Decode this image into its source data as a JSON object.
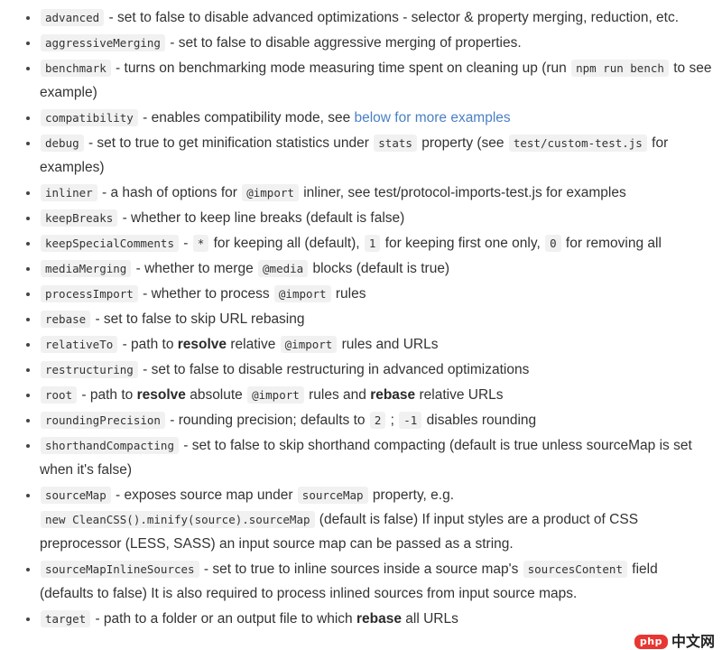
{
  "document": {
    "kind": "markdown-options-list",
    "link_color": "#4a80c4",
    "code_background": "#f1f1f1",
    "text_color": "#333333",
    "options": [
      {
        "id": "advanced",
        "parts": [
          {
            "t": "code",
            "v": "advanced"
          },
          {
            "t": "text",
            "v": " - set to false to disable advanced optimizations - selector & property merging, reduction, etc."
          }
        ]
      },
      {
        "id": "aggressiveMerging",
        "parts": [
          {
            "t": "code",
            "v": "aggressiveMerging"
          },
          {
            "t": "text",
            "v": " - set to false to disable aggressive merging of properties."
          }
        ]
      },
      {
        "id": "benchmark",
        "parts": [
          {
            "t": "code",
            "v": "benchmark"
          },
          {
            "t": "text",
            "v": " - turns on benchmarking mode measuring time spent on cleaning up (run "
          },
          {
            "t": "code",
            "v": "npm run bench"
          },
          {
            "t": "text",
            "v": " to see example)"
          }
        ]
      },
      {
        "id": "compatibility",
        "parts": [
          {
            "t": "code",
            "v": "compatibility"
          },
          {
            "t": "text",
            "v": " - enables compatibility mode, see "
          },
          {
            "t": "link",
            "v": "below for more examples"
          }
        ]
      },
      {
        "id": "debug",
        "parts": [
          {
            "t": "code",
            "v": "debug"
          },
          {
            "t": "text",
            "v": " - set to true to get minification statistics under "
          },
          {
            "t": "code",
            "v": "stats"
          },
          {
            "t": "text",
            "v": " property (see "
          },
          {
            "t": "code",
            "v": "test/custom-test.js"
          },
          {
            "t": "text",
            "v": " for examples)"
          }
        ]
      },
      {
        "id": "inliner",
        "parts": [
          {
            "t": "code",
            "v": "inliner"
          },
          {
            "t": "text",
            "v": " - a hash of options for "
          },
          {
            "t": "code",
            "v": "@import"
          },
          {
            "t": "text",
            "v": " inliner, see test/protocol-imports-test.js for examples"
          }
        ]
      },
      {
        "id": "keepBreaks",
        "parts": [
          {
            "t": "code",
            "v": "keepBreaks"
          },
          {
            "t": "text",
            "v": " - whether to keep line breaks (default is false)"
          }
        ]
      },
      {
        "id": "keepSpecialComments",
        "parts": [
          {
            "t": "code",
            "v": "keepSpecialComments"
          },
          {
            "t": "text",
            "v": " - "
          },
          {
            "t": "code",
            "v": "*"
          },
          {
            "t": "text",
            "v": " for keeping all (default), "
          },
          {
            "t": "code",
            "v": "1"
          },
          {
            "t": "text",
            "v": " for keeping first one only, "
          },
          {
            "t": "code",
            "v": "0"
          },
          {
            "t": "text",
            "v": " for removing all"
          }
        ]
      },
      {
        "id": "mediaMerging",
        "parts": [
          {
            "t": "code",
            "v": "mediaMerging"
          },
          {
            "t": "text",
            "v": " - whether to merge "
          },
          {
            "t": "code",
            "v": "@media"
          },
          {
            "t": "text",
            "v": " blocks (default is true)"
          }
        ]
      },
      {
        "id": "processImport",
        "parts": [
          {
            "t": "code",
            "v": "processImport"
          },
          {
            "t": "text",
            "v": " - whether to process "
          },
          {
            "t": "code",
            "v": "@import"
          },
          {
            "t": "text",
            "v": " rules"
          }
        ]
      },
      {
        "id": "rebase",
        "parts": [
          {
            "t": "code",
            "v": "rebase"
          },
          {
            "t": "text",
            "v": " - set to false to skip URL rebasing"
          }
        ]
      },
      {
        "id": "relativeTo",
        "parts": [
          {
            "t": "code",
            "v": "relativeTo"
          },
          {
            "t": "text",
            "v": " - path to "
          },
          {
            "t": "bold",
            "v": "resolve"
          },
          {
            "t": "text",
            "v": " relative "
          },
          {
            "t": "code",
            "v": "@import"
          },
          {
            "t": "text",
            "v": " rules and URLs"
          }
        ]
      },
      {
        "id": "restructuring",
        "parts": [
          {
            "t": "code",
            "v": "restructuring"
          },
          {
            "t": "text",
            "v": " - set to false to disable restructuring in advanced optimizations"
          }
        ]
      },
      {
        "id": "root",
        "parts": [
          {
            "t": "code",
            "v": "root"
          },
          {
            "t": "text",
            "v": " - path to "
          },
          {
            "t": "bold",
            "v": "resolve"
          },
          {
            "t": "text",
            "v": " absolute "
          },
          {
            "t": "code",
            "v": "@import"
          },
          {
            "t": "text",
            "v": " rules and "
          },
          {
            "t": "bold",
            "v": "rebase"
          },
          {
            "t": "text",
            "v": " relative URLs"
          }
        ]
      },
      {
        "id": "roundingPrecision",
        "parts": [
          {
            "t": "code",
            "v": "roundingPrecision"
          },
          {
            "t": "text",
            "v": " - rounding precision; defaults to "
          },
          {
            "t": "code",
            "v": "2"
          },
          {
            "t": "text",
            "v": " ; "
          },
          {
            "t": "code",
            "v": "-1"
          },
          {
            "t": "text",
            "v": " disables rounding"
          }
        ]
      },
      {
        "id": "shorthandCompacting",
        "parts": [
          {
            "t": "code",
            "v": "shorthandCompacting"
          },
          {
            "t": "text",
            "v": " - set to false to skip shorthand compacting (default is true unless sourceMap is set when it's false)"
          }
        ]
      },
      {
        "id": "sourceMap",
        "parts": [
          {
            "t": "code",
            "v": "sourceMap"
          },
          {
            "t": "text",
            "v": " - exposes source map under "
          },
          {
            "t": "code",
            "v": "sourceMap"
          },
          {
            "t": "text",
            "v": " property, e.g. "
          },
          {
            "t": "code",
            "v": "new CleanCSS().minify(source).sourceMap"
          },
          {
            "t": "text",
            "v": " (default is false) If input styles are a product of CSS preprocessor (LESS, SASS) an input source map can be passed as a string."
          }
        ]
      },
      {
        "id": "sourceMapInlineSources",
        "parts": [
          {
            "t": "code",
            "v": "sourceMapInlineSources"
          },
          {
            "t": "text",
            "v": " - set to true to inline sources inside a source map's "
          },
          {
            "t": "code",
            "v": "sourcesContent"
          },
          {
            "t": "text",
            "v": " field (defaults to false) It is also required to process inlined sources from input source maps."
          }
        ]
      },
      {
        "id": "target",
        "parts": [
          {
            "t": "code",
            "v": "target"
          },
          {
            "t": "text",
            "v": " - path to a folder or an output file to which "
          },
          {
            "t": "bold",
            "v": "rebase"
          },
          {
            "t": "text",
            "v": " all URLs"
          }
        ]
      }
    ]
  },
  "watermark": {
    "badge": "php",
    "text": "中文网",
    "badge_color": "#e8302c"
  }
}
